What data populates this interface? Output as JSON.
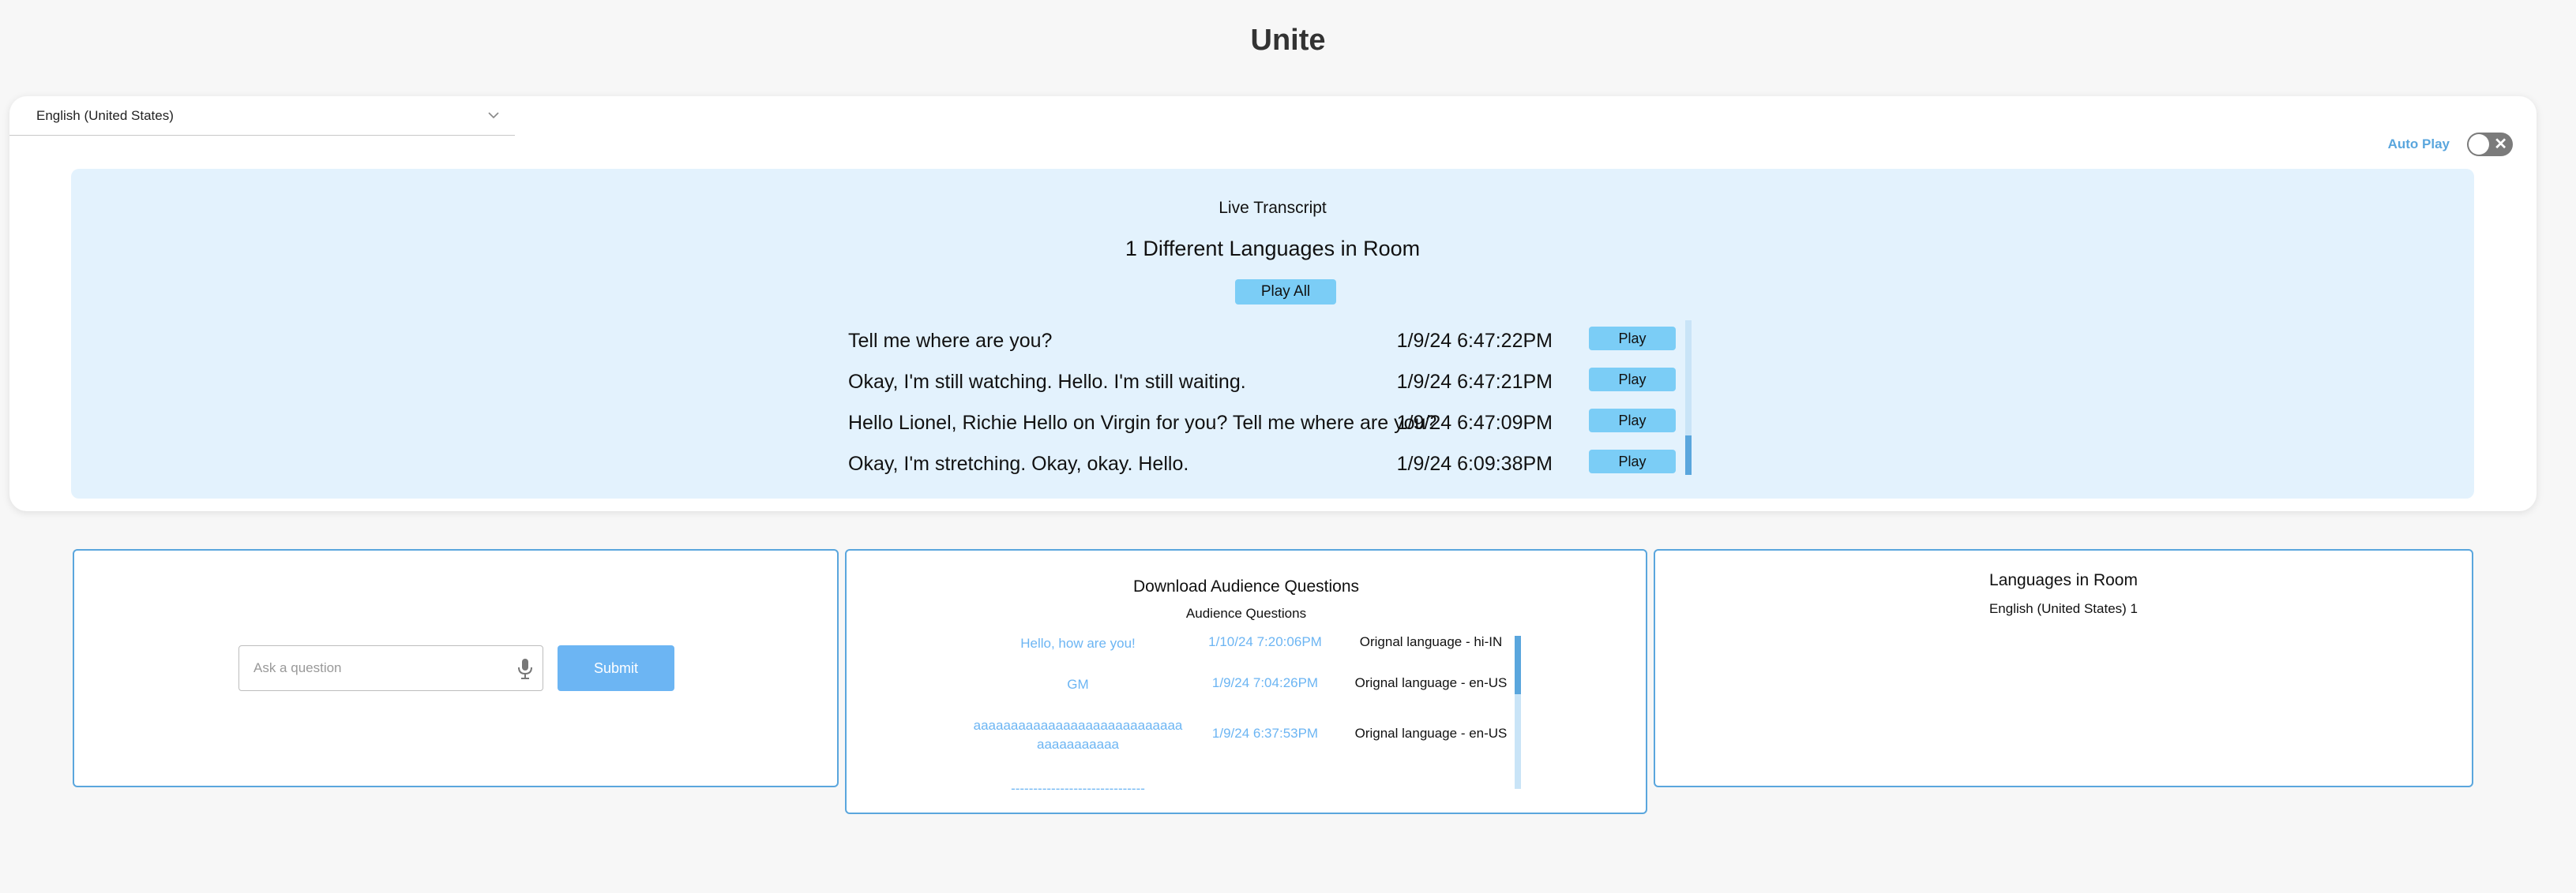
{
  "app": {
    "title": "Unite"
  },
  "language_select": {
    "value": "English (United States)"
  },
  "autoplay": {
    "label": "Auto Play",
    "enabled": false
  },
  "transcript": {
    "heading": "Live Transcript",
    "languages_heading": "1 Different Languages in Room",
    "play_all_label": "Play All",
    "rows": [
      {
        "text": "Tell me where are you?",
        "time": "1/9/24 6:47:22PM",
        "play_label": "Play"
      },
      {
        "text": "Okay, I'm still watching. Hello. I'm still waiting.",
        "time": "1/9/24 6:47:21PM",
        "play_label": "Play"
      },
      {
        "text": "Hello Lionel, Richie Hello on Virgin for you? Tell me where are you?",
        "time": "1/9/24 6:47:09PM",
        "play_label": "Play"
      },
      {
        "text": "Okay, I'm stretching. Okay, okay. Hello.",
        "time": "1/9/24 6:09:38PM",
        "play_label": "Play"
      }
    ]
  },
  "ask": {
    "placeholder": "Ask a question",
    "submit_label": "Submit"
  },
  "questions": {
    "title": "Download Audience Questions",
    "subtitle": "Audience Questions",
    "rows": [
      {
        "text": "Hello, how are you!",
        "time": "1/10/24 7:20:06PM",
        "language": "Orignal language - hi-IN"
      },
      {
        "text": "GM",
        "time": "1/9/24 7:04:26PM",
        "language": "Orignal language - en-US"
      },
      {
        "text": "aaaaaaaaaaaaaaaaaaaaaaaaaaaaaaaaaaaaaaa",
        "time": "1/9/24 6:37:53PM",
        "language": "Orignal language - en-US"
      },
      {
        "text": "------------------------------",
        "time": "",
        "language": ""
      }
    ]
  },
  "rooms": {
    "title": "Languages in Room",
    "items": [
      "English (United States) 1"
    ]
  },
  "colors": {
    "accent": "#5aa6dd",
    "panel": "#e3f2fd",
    "play_button": "#7bcdf6",
    "submit_button": "#6cb5f3"
  }
}
